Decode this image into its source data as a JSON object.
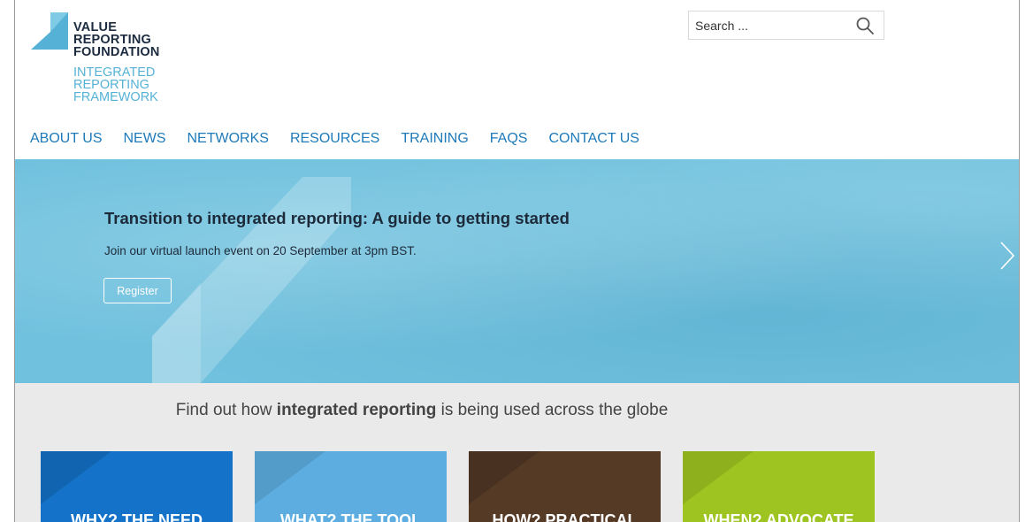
{
  "logo": {
    "line1": "VALUE",
    "line2": "REPORTING",
    "line3": "FOUNDATION",
    "line4": "INTEGRATED",
    "line5": "REPORTING",
    "line6": "FRAMEWORK",
    "colors": {
      "dark": "#1c2b3f",
      "light": "#55b2d6"
    }
  },
  "search": {
    "placeholder": "Search ...",
    "icon": "search-icon"
  },
  "nav": {
    "items": [
      {
        "label": "ABOUT US"
      },
      {
        "label": "NEWS"
      },
      {
        "label": "NETWORKS"
      },
      {
        "label": "RESOURCES"
      },
      {
        "label": "TRAINING"
      },
      {
        "label": "FAQS"
      },
      {
        "label": "CONTACT US"
      }
    ]
  },
  "hero": {
    "title": "Transition to integrated reporting: A guide to getting started",
    "subtitle": "Join our virtual launch event on 20 September at 3pm BST.",
    "button_label": "Register",
    "next_icon": "chevron-right-icon"
  },
  "tagline": {
    "prefix": "Find out how ",
    "bold": "integrated reporting",
    "suffix": " is being used across the globe"
  },
  "tiles": [
    {
      "label": "WHY? THE NEED",
      "color": "#1473c9"
    },
    {
      "label": "WHAT? THE TOOL",
      "color": "#5dade0"
    },
    {
      "label": "HOW? PRACTICAL",
      "color": "#553a26"
    },
    {
      "label": "WHEN? ADVOCATE",
      "color": "#9dc420"
    }
  ]
}
